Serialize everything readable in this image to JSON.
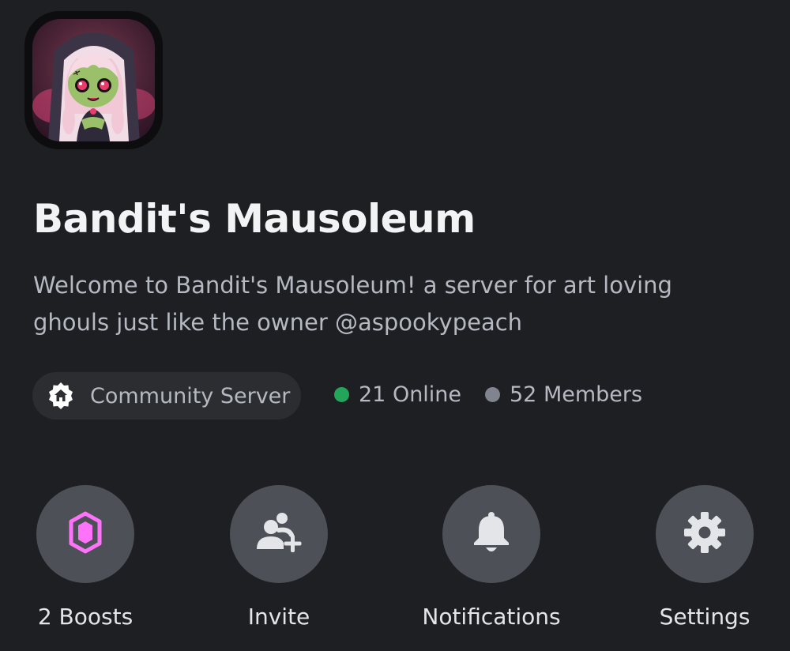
{
  "server": {
    "name": "Bandit's Mausoleum",
    "description": "Welcome to Bandit's Mausoleum! a server for art loving ghouls just like the owner @aspookypeach",
    "icon": "server-avatar"
  },
  "badge": {
    "label": "Community Server",
    "icon": "home-icon"
  },
  "stats": {
    "online": {
      "label": "21 Online",
      "color": "#23a55a"
    },
    "members": {
      "label": "52 Members",
      "color": "#80848e"
    }
  },
  "actions": [
    {
      "label": "2 Boosts",
      "icon": "boost-gem-icon",
      "accent": "#ff73fa"
    },
    {
      "label": "Invite",
      "icon": "add-user-icon"
    },
    {
      "label": "Notifications",
      "icon": "bell-icon"
    },
    {
      "label": "Settings",
      "icon": "gear-icon"
    }
  ],
  "colors": {
    "background": "#1e1f23",
    "chip": "#2b2d31",
    "action_circle": "#4e5058"
  }
}
